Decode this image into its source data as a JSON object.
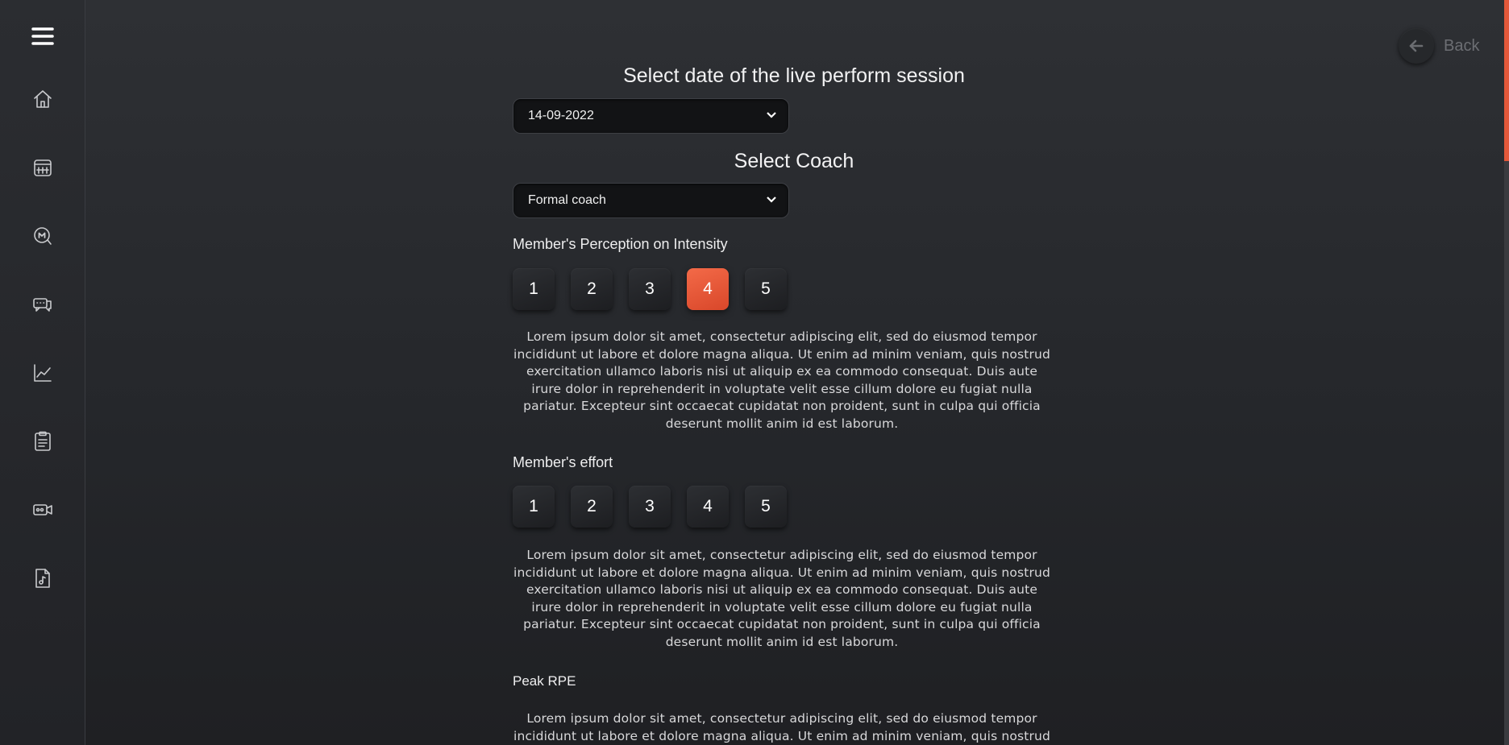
{
  "sidebar": {
    "items": [
      {
        "icon": "menu-icon"
      },
      {
        "icon": "home-icon"
      },
      {
        "icon": "calendar-icon"
      },
      {
        "icon": "chat-m-icon"
      },
      {
        "icon": "messages-icon"
      },
      {
        "icon": "chart-icon"
      },
      {
        "icon": "clipboard-icon"
      },
      {
        "icon": "video-icon"
      },
      {
        "icon": "music-file-icon"
      }
    ]
  },
  "header": {
    "back_label": "Back"
  },
  "form": {
    "date_heading": "Select date of the live perform session",
    "date_value": "14-09-2022",
    "coach_heading": "Select Coach",
    "coach_value": "Formal coach",
    "intensity": {
      "label": "Member's Perception on Intensity",
      "options": [
        "1",
        "2",
        "3",
        "4",
        "5"
      ],
      "selected": "4",
      "description": "Lorem ipsum dolor sit amet, consectetur adipiscing elit, sed do eiusmod tempor incididunt ut labore et dolore magna aliqua. Ut enim ad minim veniam, quis nostrud exercitation ullamco laboris nisi ut aliquip ex ea commodo consequat. Duis aute irure dolor in reprehenderit in voluptate velit esse cillum dolore eu fugiat nulla pariatur. Excepteur sint occaecat cupidatat non proident, sunt in culpa qui officia deserunt mollit anim id est laborum."
    },
    "effort": {
      "label": "Member's effort",
      "options": [
        "1",
        "2",
        "3",
        "4",
        "5"
      ],
      "selected": null,
      "description": "Lorem ipsum dolor sit amet, consectetur adipiscing elit, sed do eiusmod tempor incididunt ut labore et dolore magna aliqua. Ut enim ad minim veniam, quis nostrud exercitation ullamco laboris nisi ut aliquip ex ea commodo consequat. Duis aute irure dolor in reprehenderit in voluptate velit esse cillum dolore eu fugiat nulla pariatur. Excepteur sint occaecat cupidatat non proident, sunt in culpa qui officia deserunt mollit anim id est laborum."
    },
    "peak_rpe": {
      "label": "Peak RPE",
      "description": "Lorem ipsum dolor sit amet, consectetur adipiscing elit, sed do eiusmod tempor incididunt ut labore et dolore magna aliqua. Ut enim ad minim veniam, quis nostrud"
    }
  },
  "colors": {
    "accent": "#e8573a",
    "background": "#25272b"
  }
}
